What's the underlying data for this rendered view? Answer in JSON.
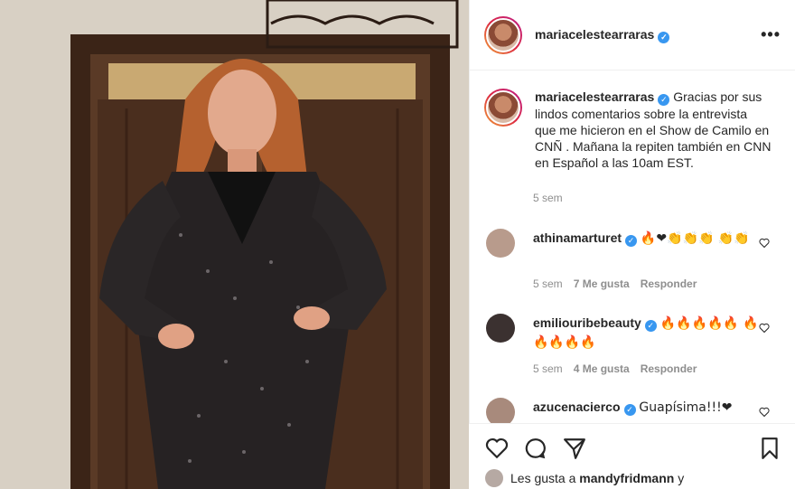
{
  "post": {
    "username": "mariacelestearraras",
    "more_label": "•••"
  },
  "caption": {
    "username": "mariacelestearraras",
    "text": "Gracias por sus lindos comentarios sobre la entrevista que me hicieron en el Show de Camilo en CNÑ . Mañana la repiten también en CNN en Español a las 10am EST.",
    "time": "5 sem"
  },
  "comments": [
    {
      "username": "athinamarturet",
      "text": "🔥❤👏👏👏 👏👏",
      "time": "5 sem",
      "likes": "7 Me gusta",
      "reply": "Responder"
    },
    {
      "username": "emiliouribebeauty",
      "text": "🔥🔥🔥🔥🔥 🔥🔥🔥🔥🔥",
      "time": "5 sem",
      "likes": "4 Me gusta",
      "reply": "Responder"
    },
    {
      "username": "azucenacierco",
      "text": "Guapísima!!!❤",
      "time": "",
      "likes": "",
      "reply": ""
    }
  ],
  "likes_bar": {
    "prefix": "Les gusta a",
    "user": "mandyfridmann",
    "suffix": "y"
  },
  "colors": {
    "verified": "#3897f0",
    "muted": "#8e8e8e",
    "text": "#262626"
  },
  "icons": [
    "heart-icon",
    "comment-icon",
    "share-icon",
    "bookmark-icon",
    "verified-icon",
    "more-icon"
  ]
}
